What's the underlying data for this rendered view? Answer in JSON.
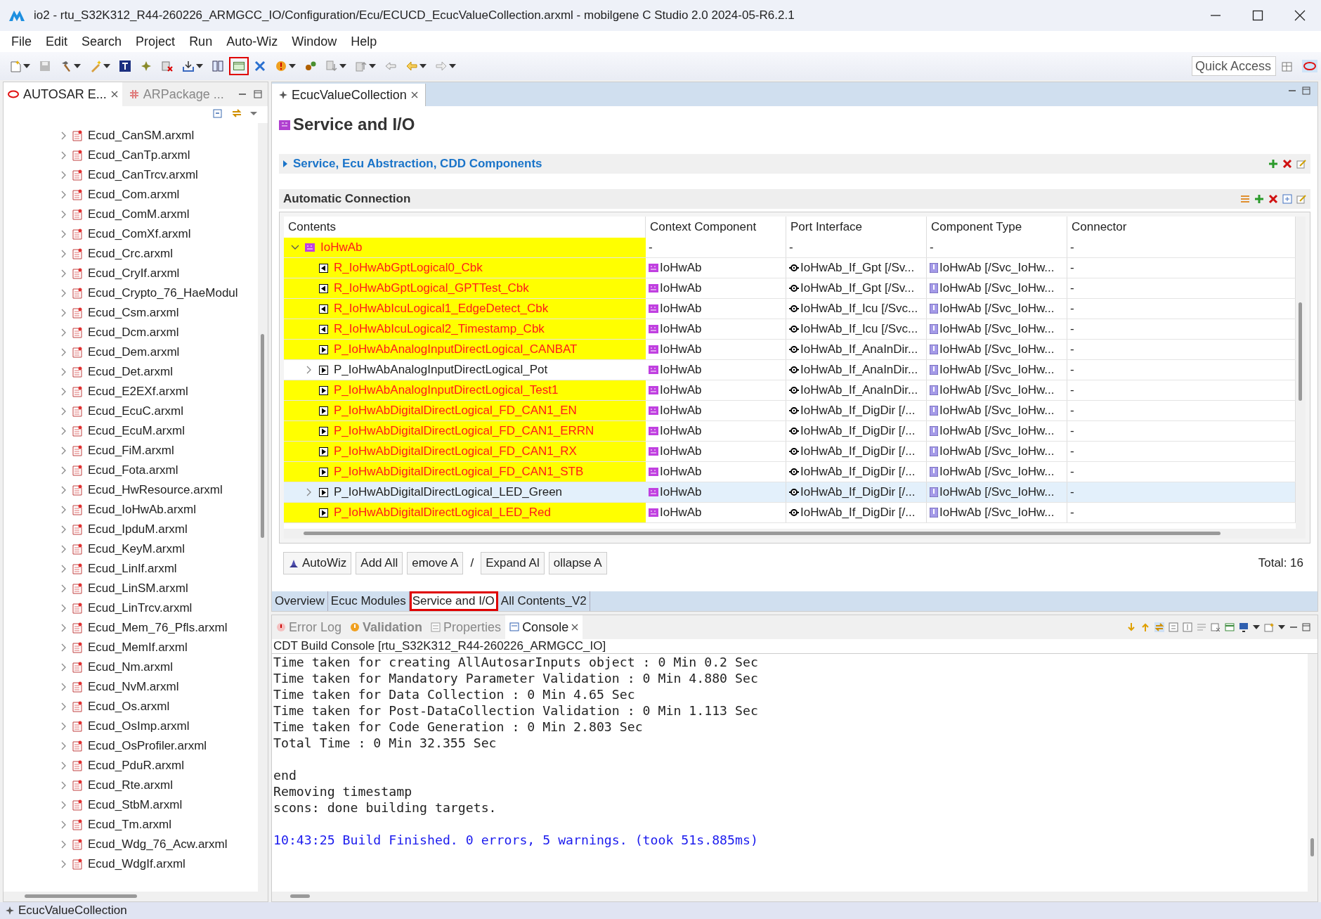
{
  "window": {
    "title": "io2 - rtu_S32K312_R44-260226_ARMGCC_IO/Configuration/Ecu/ECUCD_EcucValueCollection.arxml - mobilgene C Studio 2.0 2024-05-R6.2.1"
  },
  "menu": [
    "File",
    "Edit",
    "Search",
    "Project",
    "Run",
    "Auto-Wiz",
    "Window",
    "Help"
  ],
  "toolbar": [
    {
      "kind": "file",
      "dropdown": true,
      "annotated": false
    },
    {
      "kind": "save",
      "dropdown": false,
      "annotated": false
    },
    {
      "kind": "hammer",
      "dropdown": true,
      "annotated": false
    },
    {
      "kind": "wand",
      "dropdown": true,
      "annotated": false
    },
    {
      "kind": "text",
      "dropdown": false,
      "annotated": false
    },
    {
      "kind": "star",
      "dropdown": false,
      "annotated": false
    },
    {
      "kind": "cross",
      "dropdown": false,
      "annotated": false
    },
    {
      "kind": "import",
      "dropdown": true,
      "annotated": false
    },
    {
      "kind": "split",
      "dropdown": false,
      "annotated": false
    },
    {
      "kind": "window",
      "dropdown": false,
      "annotated": true
    },
    {
      "kind": "tools",
      "dropdown": false,
      "annotated": false
    },
    {
      "kind": "alert",
      "dropdown": true,
      "annotated": false
    },
    {
      "kind": "gear",
      "dropdown": false,
      "annotated": false
    },
    {
      "kind": "down",
      "dropdown": true,
      "annotated": false
    },
    {
      "kind": "up",
      "dropdown": true,
      "annotated": false
    },
    {
      "kind": "back",
      "dropdown": false,
      "annotated": false
    },
    {
      "kind": "left",
      "dropdown": true,
      "annotated": false
    },
    {
      "kind": "right",
      "dropdown": true,
      "annotated": false
    }
  ],
  "quick_access": {
    "placeholder": "Quick Access"
  },
  "left_panel": {
    "tabs": [
      {
        "label": "AUTOSAR E...",
        "selected": true
      },
      {
        "label": "ARPackage ...",
        "selected": false
      }
    ],
    "items": [
      "Ecud_CanSM.arxml",
      "Ecud_CanTp.arxml",
      "Ecud_CanTrcv.arxml",
      "Ecud_Com.arxml",
      "Ecud_ComM.arxml",
      "Ecud_ComXf.arxml",
      "Ecud_Crc.arxml",
      "Ecud_CryIf.arxml",
      "Ecud_Crypto_76_HaeModul",
      "Ecud_Csm.arxml",
      "Ecud_Dcm.arxml",
      "Ecud_Dem.arxml",
      "Ecud_Det.arxml",
      "Ecud_E2EXf.arxml",
      "Ecud_EcuC.arxml",
      "Ecud_EcuM.arxml",
      "Ecud_FiM.arxml",
      "Ecud_Fota.arxml",
      "Ecud_HwResource.arxml",
      "Ecud_IoHwAb.arxml",
      "Ecud_IpduM.arxml",
      "Ecud_KeyM.arxml",
      "Ecud_LinIf.arxml",
      "Ecud_LinSM.arxml",
      "Ecud_LinTrcv.arxml",
      "Ecud_Mem_76_Pfls.arxml",
      "Ecud_MemIf.arxml",
      "Ecud_Nm.arxml",
      "Ecud_NvM.arxml",
      "Ecud_Os.arxml",
      "Ecud_OsImp.arxml",
      "Ecud_OsProfiler.arxml",
      "Ecud_PduR.arxml",
      "Ecud_Rte.arxml",
      "Ecud_StbM.arxml",
      "Ecud_Tm.arxml",
      "Ecud_Wdg_76_Acw.arxml",
      "Ecud_WdgIf.arxml"
    ]
  },
  "editor": {
    "tab": "EcucValueCollection",
    "title": "Service and I/O",
    "section": {
      "label": "Service, Ecu Abstraction, CDD Components",
      "expanded": false
    },
    "auto_section": "Automatic Connection",
    "table": {
      "columns": [
        "Contents",
        "Context Component",
        "Port Interface",
        "Component Type",
        "Connector"
      ],
      "root": {
        "expanded": true,
        "highlighted": true,
        "cells": [
          "IoHwAb",
          "-",
          "-",
          "-",
          "-"
        ]
      },
      "rows": [
        {
          "kind": "required",
          "highlighted": true,
          "expandable": false,
          "selected": false,
          "cells": [
            "R_IoHwAbGptLogical0_Cbk",
            "IoHwAb",
            "IoHwAb_If_Gpt [/Sv...",
            "IoHwAb [/Svc_IoHw...",
            "-"
          ]
        },
        {
          "kind": "required",
          "highlighted": true,
          "expandable": false,
          "selected": false,
          "cells": [
            "R_IoHwAbGptLogical_GPTTest_Cbk",
            "IoHwAb",
            "IoHwAb_If_Gpt [/Sv...",
            "IoHwAb [/Svc_IoHw...",
            "-"
          ]
        },
        {
          "kind": "required",
          "highlighted": true,
          "expandable": false,
          "selected": false,
          "cells": [
            "R_IoHwAbIcuLogical1_EdgeDetect_Cbk",
            "IoHwAb",
            "IoHwAb_If_Icu [/Svc...",
            "IoHwAb [/Svc_IoHw...",
            "-"
          ]
        },
        {
          "kind": "required",
          "highlighted": true,
          "expandable": false,
          "selected": false,
          "cells": [
            "R_IoHwAbIcuLogical2_Timestamp_Cbk",
            "IoHwAb",
            "IoHwAb_If_Icu [/Svc...",
            "IoHwAb [/Svc_IoHw...",
            "-"
          ]
        },
        {
          "kind": "provided",
          "highlighted": true,
          "expandable": false,
          "selected": false,
          "cells": [
            "P_IoHwAbAnalogInputDirectLogical_CANBAT",
            "IoHwAb",
            "IoHwAb_If_AnaInDir...",
            "IoHwAb [/Svc_IoHw...",
            "-"
          ]
        },
        {
          "kind": "provided",
          "highlighted": false,
          "expandable": true,
          "selected": false,
          "cells": [
            "P_IoHwAbAnalogInputDirectLogical_Pot",
            "IoHwAb",
            "IoHwAb_If_AnaInDir...",
            "IoHwAb [/Svc_IoHw...",
            "-"
          ]
        },
        {
          "kind": "provided",
          "highlighted": true,
          "expandable": false,
          "selected": false,
          "cells": [
            "P_IoHwAbAnalogInputDirectLogical_Test1",
            "IoHwAb",
            "IoHwAb_If_AnaInDir...",
            "IoHwAb [/Svc_IoHw...",
            "-"
          ]
        },
        {
          "kind": "provided",
          "highlighted": true,
          "expandable": false,
          "selected": false,
          "cells": [
            "P_IoHwAbDigitalDirectLogical_FD_CAN1_EN",
            "IoHwAb",
            "IoHwAb_If_DigDir [/...",
            "IoHwAb [/Svc_IoHw...",
            "-"
          ]
        },
        {
          "kind": "provided",
          "highlighted": true,
          "expandable": false,
          "selected": false,
          "cells": [
            "P_IoHwAbDigitalDirectLogical_FD_CAN1_ERRN",
            "IoHwAb",
            "IoHwAb_If_DigDir [/...",
            "IoHwAb [/Svc_IoHw...",
            "-"
          ]
        },
        {
          "kind": "provided",
          "highlighted": true,
          "expandable": false,
          "selected": false,
          "cells": [
            "P_IoHwAbDigitalDirectLogical_FD_CAN1_RX",
            "IoHwAb",
            "IoHwAb_If_DigDir [/...",
            "IoHwAb [/Svc_IoHw...",
            "-"
          ]
        },
        {
          "kind": "provided",
          "highlighted": true,
          "expandable": false,
          "selected": false,
          "cells": [
            "P_IoHwAbDigitalDirectLogical_FD_CAN1_STB",
            "IoHwAb",
            "IoHwAb_If_DigDir [/...",
            "IoHwAb [/Svc_IoHw...",
            "-"
          ]
        },
        {
          "kind": "provided",
          "highlighted": false,
          "expandable": true,
          "selected": true,
          "cells": [
            "P_IoHwAbDigitalDirectLogical_LED_Green",
            "IoHwAb",
            "IoHwAb_If_DigDir [/...",
            "IoHwAb [/Svc_IoHw...",
            "-"
          ]
        },
        {
          "kind": "provided",
          "highlighted": true,
          "expandable": false,
          "selected": false,
          "cells": [
            "P_IoHwAbDigitalDirectLogical_LED_Red",
            "IoHwAb",
            "IoHwAb_If_DigDir [/...",
            "IoHwAb [/Svc_IoHw...",
            "-"
          ]
        }
      ]
    },
    "buttons": [
      {
        "label": "AutoWiz",
        "icon": true
      },
      {
        "label": "Add All",
        "icon": false
      },
      {
        "label": "emove A",
        "icon": false
      },
      {
        "label": "Expand Al",
        "icon": false
      },
      {
        "label": "ollapse A",
        "icon": false
      }
    ],
    "separator": "/",
    "total": "Total: 16",
    "pages": [
      {
        "label": "Overview",
        "selected": false,
        "annotated": false
      },
      {
        "label": "Ecuc Modules",
        "selected": false,
        "annotated": false
      },
      {
        "label": "Service and I/O",
        "selected": true,
        "annotated": true
      },
      {
        "label": "All Contents_V2",
        "selected": false,
        "annotated": false
      }
    ]
  },
  "console": {
    "tabs": [
      {
        "label": "Error Log",
        "selected": false,
        "kind": "log"
      },
      {
        "label": "Validation",
        "selected": false,
        "kind": "validation"
      },
      {
        "label": "Properties",
        "selected": false,
        "kind": "properties"
      },
      {
        "label": "Console",
        "selected": true,
        "kind": "console"
      }
    ],
    "title": "CDT Build Console [rtu_S32K312_R44-260226_ARMGCC_IO]",
    "lines": [
      {
        "text": "Time taken for creating AllAutosarInputs object : 0 Min 0.2 Sec",
        "kind": "output",
        "gap_before": false
      },
      {
        "text": "Time taken for Mandatory Parameter Validation : 0 Min 4.880 Sec",
        "kind": "output",
        "gap_before": false
      },
      {
        "text": "Time taken for Data Collection : 0 Min 4.65 Sec",
        "kind": "output",
        "gap_before": false
      },
      {
        "text": "Time taken for Post-DataCollection Validation : 0 Min 1.113 Sec",
        "kind": "output",
        "gap_before": false
      },
      {
        "text": "Time taken for Code Generation : 0 Min 2.803 Sec",
        "kind": "output",
        "gap_before": false
      },
      {
        "text": "Total Time : 0 Min 32.355 Sec",
        "kind": "output",
        "gap_before": false
      },
      {
        "text": "end",
        "kind": "output",
        "gap_before": true
      },
      {
        "text": "Removing timestamp",
        "kind": "output",
        "gap_before": false
      },
      {
        "text": "scons: done building targets.",
        "kind": "output",
        "gap_before": false
      },
      {
        "text": "10:43:25 Build Finished. 0 errors, 5 warnings. (took 51s.885ms)",
        "kind": "info",
        "gap_before": true
      }
    ]
  },
  "status_bar": {
    "text": "EcucValueCollection"
  }
}
